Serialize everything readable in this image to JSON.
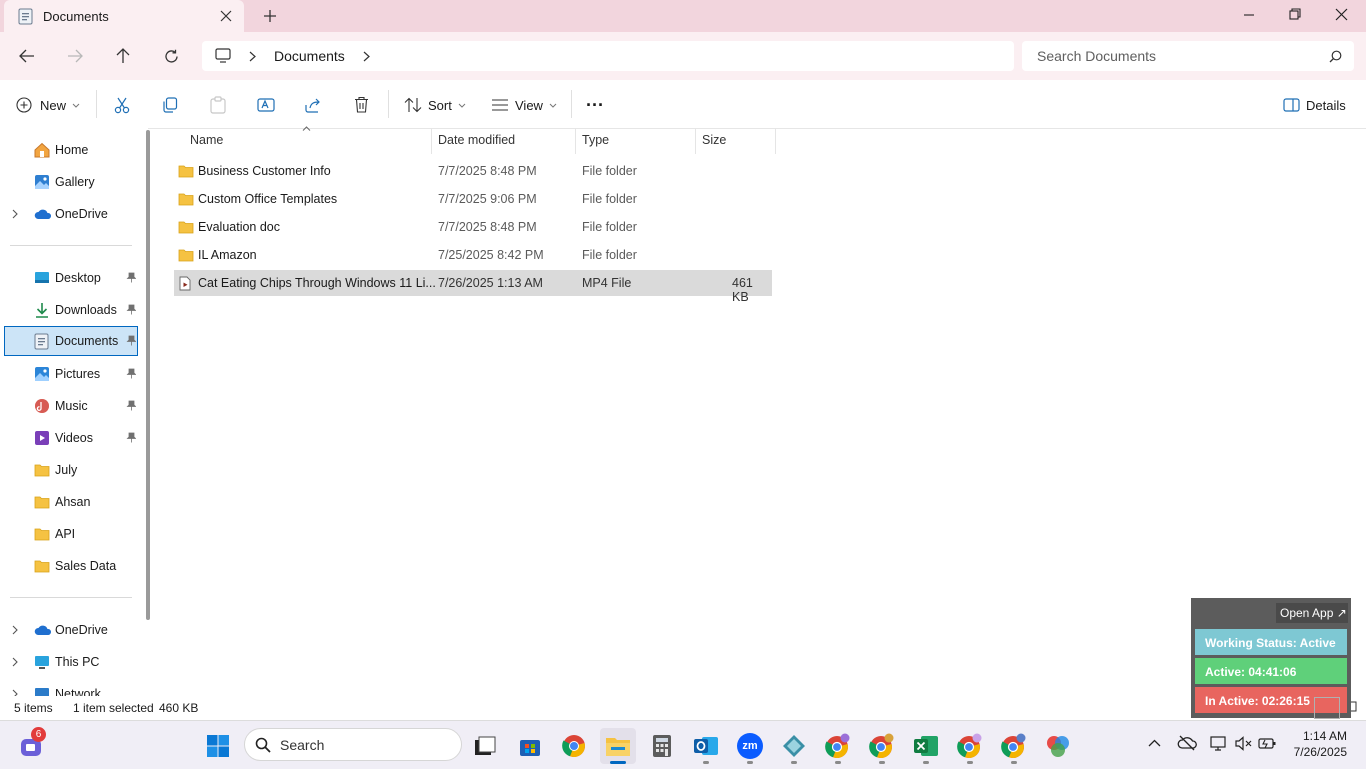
{
  "window": {
    "tab_title": "Documents",
    "tab_close_icon": "close-icon",
    "new_tab_icon": "plus-icon",
    "min_icon": "minimize-icon",
    "max_icon": "restore-icon",
    "close_icon": "close-icon"
  },
  "address": {
    "breadcrumb": [
      "Documents"
    ],
    "search_placeholder": "Search Documents"
  },
  "commandbar": {
    "new_label": "New",
    "sort_label": "Sort",
    "view_label": "View",
    "more_label": "···",
    "details_label": "Details"
  },
  "sidebar": {
    "home": "Home",
    "gallery": "Gallery",
    "onedrive_top": "OneDrive",
    "desktop": "Desktop",
    "downloads": "Downloads",
    "documents": "Documents",
    "pictures": "Pictures",
    "music": "Music",
    "videos": "Videos",
    "july": "July",
    "ahsan": "Ahsan",
    "api": "API",
    "sales_data": "Sales Data",
    "onedrive_bottom": "OneDrive",
    "this_pc": "This PC",
    "network": "Network"
  },
  "columns": {
    "name": "Name",
    "date": "Date modified",
    "type": "Type",
    "size": "Size"
  },
  "files": [
    {
      "name": "Business Customer Info",
      "date": "7/7/2025 8:48 PM",
      "type": "File folder",
      "size": ""
    },
    {
      "name": "Custom Office Templates",
      "date": "7/7/2025 9:06 PM",
      "type": "File folder",
      "size": ""
    },
    {
      "name": "Evaluation doc",
      "date": "7/7/2025 8:48 PM",
      "type": "File folder",
      "size": ""
    },
    {
      "name": "IL Amazon",
      "date": "7/25/2025 8:42 PM",
      "type": "File folder",
      "size": ""
    },
    {
      "name": "Cat Eating Chips Through Windows 11 Li...",
      "date": "7/26/2025 1:13 AM",
      "type": "MP4 File",
      "size": "461 KB"
    }
  ],
  "status": {
    "items": "5 items",
    "selected": "1 item selected",
    "selected_size": "460 KB"
  },
  "widget": {
    "open_app": "Open App ↗",
    "working_status": "Working Status: Active",
    "active": "Active: 04:41:06",
    "inactive": "In Active: 02:26:15",
    "colors": {
      "working": "#7ec8d3",
      "active": "#5fd07a",
      "inactive": "#e8655f"
    }
  },
  "taskbar": {
    "search_label": "Search",
    "badge_count": "6",
    "zoom_label": "zm",
    "time": "1:14 AM",
    "date": "7/26/2025"
  },
  "colors": {
    "titlebar": "#f2d5dd",
    "accent": "#0067c0",
    "folder": "#f5c242"
  }
}
